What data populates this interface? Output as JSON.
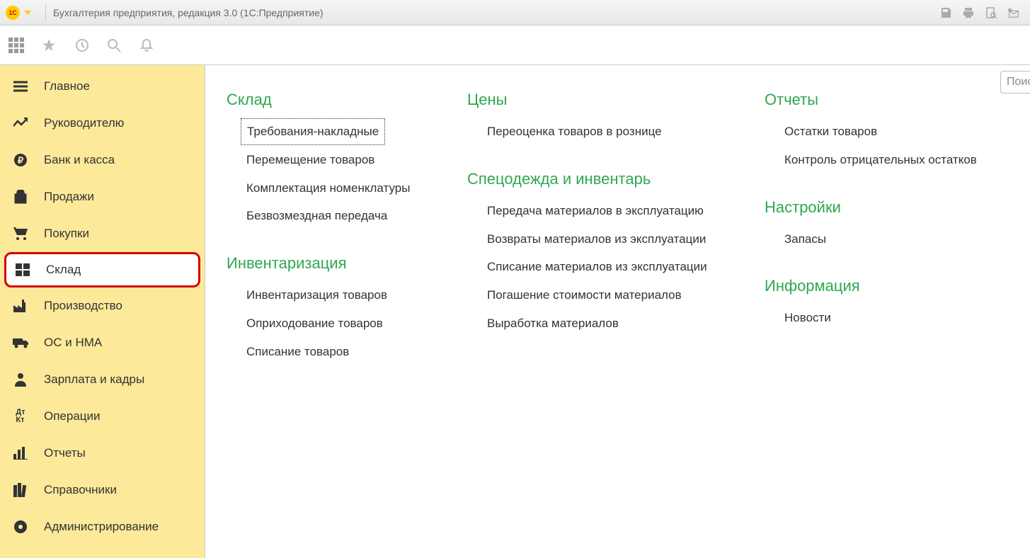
{
  "titlebar": {
    "title": "Бухгалтерия предприятия, редакция 3.0  (1С:Предприятие)"
  },
  "search": {
    "placeholder": "Поис"
  },
  "sidebar": {
    "items": [
      {
        "label": "Главное"
      },
      {
        "label": "Руководителю"
      },
      {
        "label": "Банк и касса"
      },
      {
        "label": "Продажи"
      },
      {
        "label": "Покупки"
      },
      {
        "label": "Склад"
      },
      {
        "label": "Производство"
      },
      {
        "label": "ОС и НМА"
      },
      {
        "label": "Зарплата и кадры"
      },
      {
        "label": "Операции"
      },
      {
        "label": "Отчеты"
      },
      {
        "label": "Справочники"
      },
      {
        "label": "Администрирование"
      }
    ]
  },
  "main": {
    "col1": {
      "section1": {
        "title": "Склад",
        "links": [
          "Требования-накладные",
          "Перемещение товаров",
          "Комплектация номенклатуры",
          "Безвозмездная передача"
        ]
      },
      "section2": {
        "title": "Инвентаризация",
        "links": [
          "Инвентаризация товаров",
          "Оприходование товаров",
          "Списание товаров"
        ]
      }
    },
    "col2": {
      "section1": {
        "title": "Цены",
        "links": [
          "Переоценка товаров в рознице"
        ]
      },
      "section2": {
        "title": "Спецодежда и инвентарь",
        "links": [
          "Передача материалов в эксплуатацию",
          "Возвраты материалов из эксплуатации",
          "Списание материалов из эксплуатации",
          "Погашение стоимости материалов",
          "Выработка материалов"
        ]
      }
    },
    "col3": {
      "section1": {
        "title": "Отчеты",
        "links": [
          "Остатки товаров",
          "Контроль отрицательных остатков"
        ]
      },
      "section2": {
        "title": "Настройки",
        "links": [
          "Запасы"
        ]
      },
      "section3": {
        "title": "Информация",
        "links": [
          "Новости"
        ]
      }
    }
  }
}
